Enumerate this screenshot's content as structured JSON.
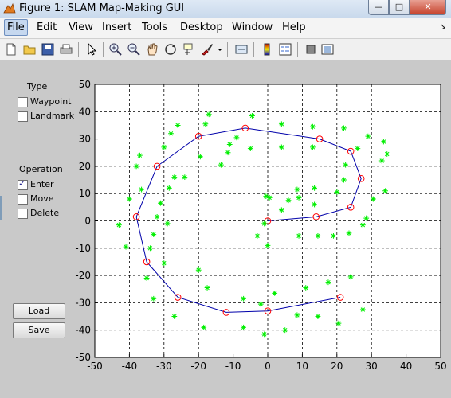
{
  "window": {
    "title": "Figure 1: SLAM Map-Making GUI",
    "min_glyph": "—",
    "max_glyph": "□",
    "close_glyph": "✕"
  },
  "menu": [
    "File",
    "Edit",
    "View",
    "Insert",
    "Tools",
    "Desktop",
    "Window",
    "Help"
  ],
  "menu_overflow": "↘",
  "toolbar_icons": [
    "new-figure-icon",
    "open-file-icon",
    "save-icon",
    "print-icon",
    "pointer-icon",
    "zoom-in-icon",
    "zoom-out-icon",
    "pan-icon",
    "rotate-3d-icon",
    "data-cursor-icon",
    "brush-icon",
    "link-icon",
    "colorbar-icon",
    "legend-icon",
    "hide-plot-tools-icon",
    "show-plot-tools-icon"
  ],
  "type_panel": {
    "title": "Type",
    "options": [
      {
        "label": "Waypoint",
        "checked": false
      },
      {
        "label": "Landmark",
        "checked": false
      }
    ]
  },
  "operation_panel": {
    "title": "Operation",
    "options": [
      {
        "label": "Enter",
        "checked": true
      },
      {
        "label": "Move",
        "checked": false
      },
      {
        "label": "Delete",
        "checked": false
      }
    ]
  },
  "buttons": {
    "load": "Load",
    "save": "Save"
  },
  "check_glyph": "✓",
  "chart_data": {
    "type": "scatter",
    "xlim": [
      -50,
      50
    ],
    "ylim": [
      -50,
      50
    ],
    "xticks": [
      -50,
      -40,
      -30,
      -20,
      -10,
      0,
      10,
      20,
      30,
      40,
      50
    ],
    "yticks": [
      -50,
      -40,
      -30,
      -20,
      -10,
      0,
      10,
      20,
      30,
      40,
      50
    ],
    "grid": true,
    "grid_style": "dashed",
    "series": [
      {
        "kind": "path",
        "color": "#0000aa",
        "marker": "circle",
        "marker_color": "#ff0000",
        "points": [
          [
            0,
            0
          ],
          [
            14,
            1.5
          ],
          [
            24,
            5
          ],
          [
            27,
            15.5
          ],
          [
            24,
            25.5
          ],
          [
            15,
            30
          ],
          [
            -6.5,
            34
          ],
          [
            -20,
            31
          ],
          [
            -32,
            20
          ],
          [
            -38,
            1.5
          ],
          [
            -35,
            -15
          ],
          [
            -26,
            -28
          ],
          [
            -12,
            -33.5
          ],
          [
            0,
            -33
          ],
          [
            21,
            -28
          ]
        ]
      },
      {
        "kind": "scatter",
        "color": "#00ee00",
        "marker": "star",
        "points": [
          [
            -17,
            39
          ],
          [
            -4.5,
            38.5
          ],
          [
            4,
            35.5
          ],
          [
            13,
            34.5
          ],
          [
            22,
            34
          ],
          [
            -26,
            35
          ],
          [
            -18,
            35.5
          ],
          [
            -28,
            32
          ],
          [
            -9,
            30.5
          ],
          [
            -11,
            28
          ],
          [
            -5,
            26.5
          ],
          [
            4,
            27
          ],
          [
            13,
            27
          ],
          [
            -30,
            27
          ],
          [
            -11.5,
            25
          ],
          [
            -19.5,
            23.5
          ],
          [
            29,
            31
          ],
          [
            33.5,
            29
          ],
          [
            26,
            26.5
          ],
          [
            34.5,
            24.5
          ],
          [
            33,
            22
          ],
          [
            22.5,
            20.5
          ],
          [
            -38,
            20
          ],
          [
            -13.5,
            20.5
          ],
          [
            -37,
            24
          ],
          [
            -27,
            16
          ],
          [
            -28.5,
            12
          ],
          [
            -31,
            6.5
          ],
          [
            -32,
            1.5
          ],
          [
            -29,
            -1
          ],
          [
            -24,
            16
          ],
          [
            -36.5,
            11.5
          ],
          [
            22,
            15
          ],
          [
            13.5,
            12
          ],
          [
            20,
            10.5
          ],
          [
            8.5,
            11.5
          ],
          [
            9,
            8.5
          ],
          [
            -0.5,
            9
          ],
          [
            0.5,
            8.5
          ],
          [
            6,
            7.5
          ],
          [
            30.5,
            8
          ],
          [
            34,
            11
          ],
          [
            4,
            4
          ],
          [
            13.5,
            6
          ],
          [
            28.5,
            1
          ],
          [
            -1,
            -1
          ],
          [
            -40,
            8
          ],
          [
            -43,
            -1.5
          ],
          [
            -41,
            -9.5
          ],
          [
            -34,
            -10
          ],
          [
            -33,
            -5
          ],
          [
            -30,
            -15.5
          ],
          [
            -3,
            -5.5
          ],
          [
            9,
            -5.5
          ],
          [
            14.5,
            -5.5
          ],
          [
            19,
            -5.5
          ],
          [
            23.5,
            -4.5
          ],
          [
            27.5,
            -1.5
          ],
          [
            0,
            -9
          ],
          [
            -35,
            -21
          ],
          [
            -20,
            -18
          ],
          [
            -33,
            -28.5
          ],
          [
            -17.5,
            -24.5
          ],
          [
            -27,
            -35
          ],
          [
            2,
            -26.5
          ],
          [
            11,
            -24.5
          ],
          [
            17.5,
            -22.5
          ],
          [
            24,
            -20.5
          ],
          [
            -7,
            -28.5
          ],
          [
            -2,
            -30.5
          ],
          [
            -18.5,
            -39
          ],
          [
            -7,
            -39
          ],
          [
            5,
            -40
          ],
          [
            -1,
            -41.5
          ],
          [
            14.5,
            -35
          ],
          [
            8.5,
            -34.5
          ],
          [
            27.5,
            -32.5
          ],
          [
            20.5,
            -37.5
          ]
        ]
      }
    ]
  }
}
